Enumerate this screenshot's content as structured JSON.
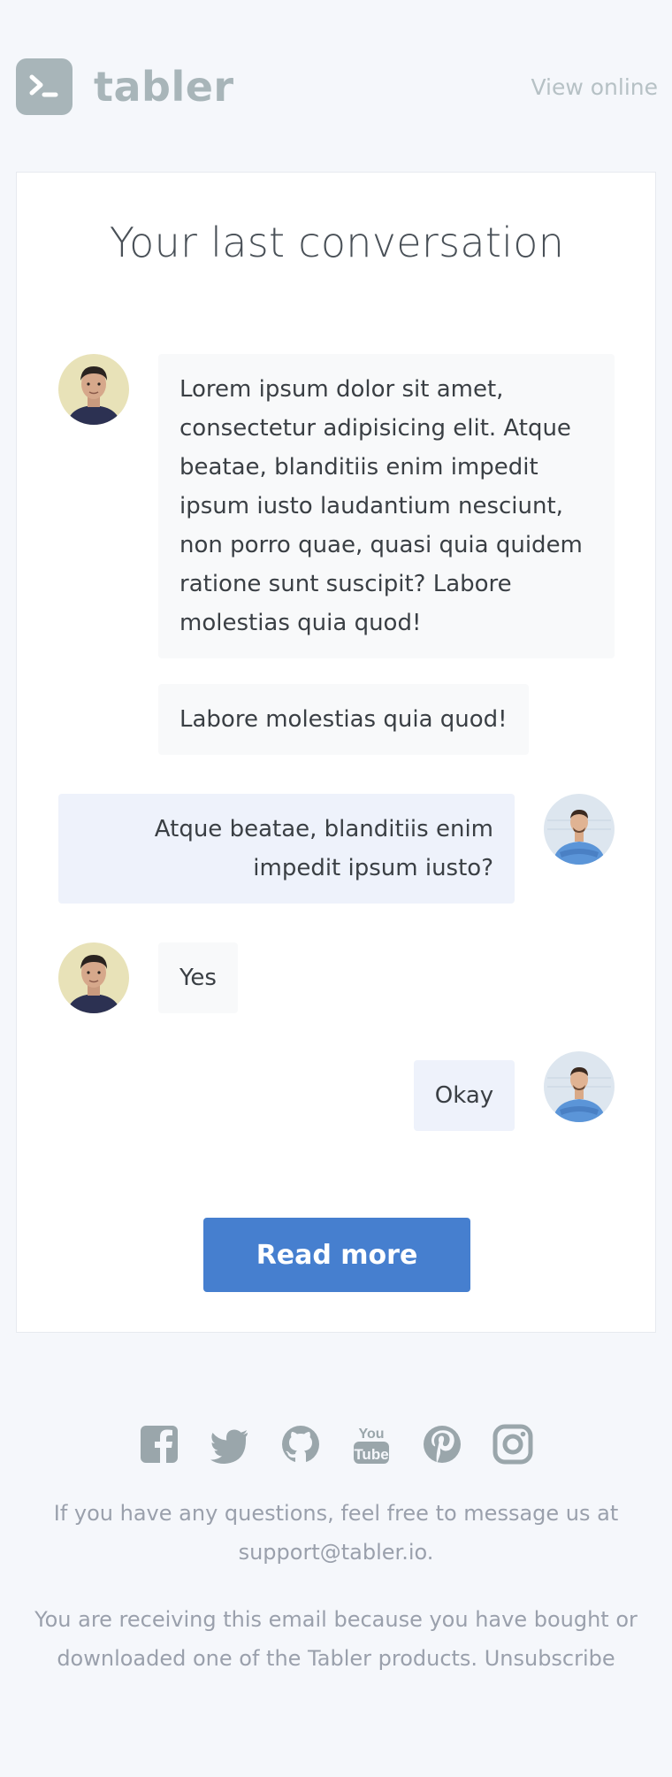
{
  "header": {
    "brand": "tabler",
    "view_online": "View online"
  },
  "card": {
    "title": "Your last conversation",
    "messages": [
      {
        "side": "left",
        "avatar": "man-dark-shirt-avatar",
        "text": "Lorem ipsum dolor sit amet, consectetur adipisicing elit. Atque beatae, blanditiis enim impedit ipsum iusto laudantium nesciunt, non porro quae, quasi quia quidem ratione sunt suscipit? Labore molestias quia quod!"
      },
      {
        "side": "left",
        "avatar": "",
        "text": "Labore molestias quia quod!"
      },
      {
        "side": "right",
        "avatar": "man-blue-shirt-avatar",
        "text": "Atque beatae, blanditiis enim impedit ipsum iusto?"
      },
      {
        "side": "left",
        "avatar": "man-dark-shirt-avatar",
        "text": "Yes"
      },
      {
        "side": "right",
        "avatar": "man-blue-shirt-avatar",
        "text": "Okay"
      }
    ],
    "button_label": "Read more"
  },
  "footer": {
    "social_icons": [
      "facebook-icon",
      "twitter-icon",
      "github-icon",
      "youtube-icon",
      "pinterest-icon",
      "instagram-icon"
    ],
    "questions_text": "If you have any questions, feel free to message us at",
    "support_email": "support@tabler.io",
    "questions_end": ".",
    "receiving_text": "You are receiving this email because you have bought or downloaded one of the Tabler products.",
    "unsubscribe": "Unsubscribe"
  },
  "colors": {
    "background": "#f5f7fb",
    "brand": "#a8b5b9",
    "primary": "#467fcf",
    "bubble_left": "#f8f9fa",
    "bubble_right": "#eef2fb",
    "muted_text": "#9aa0ac"
  }
}
